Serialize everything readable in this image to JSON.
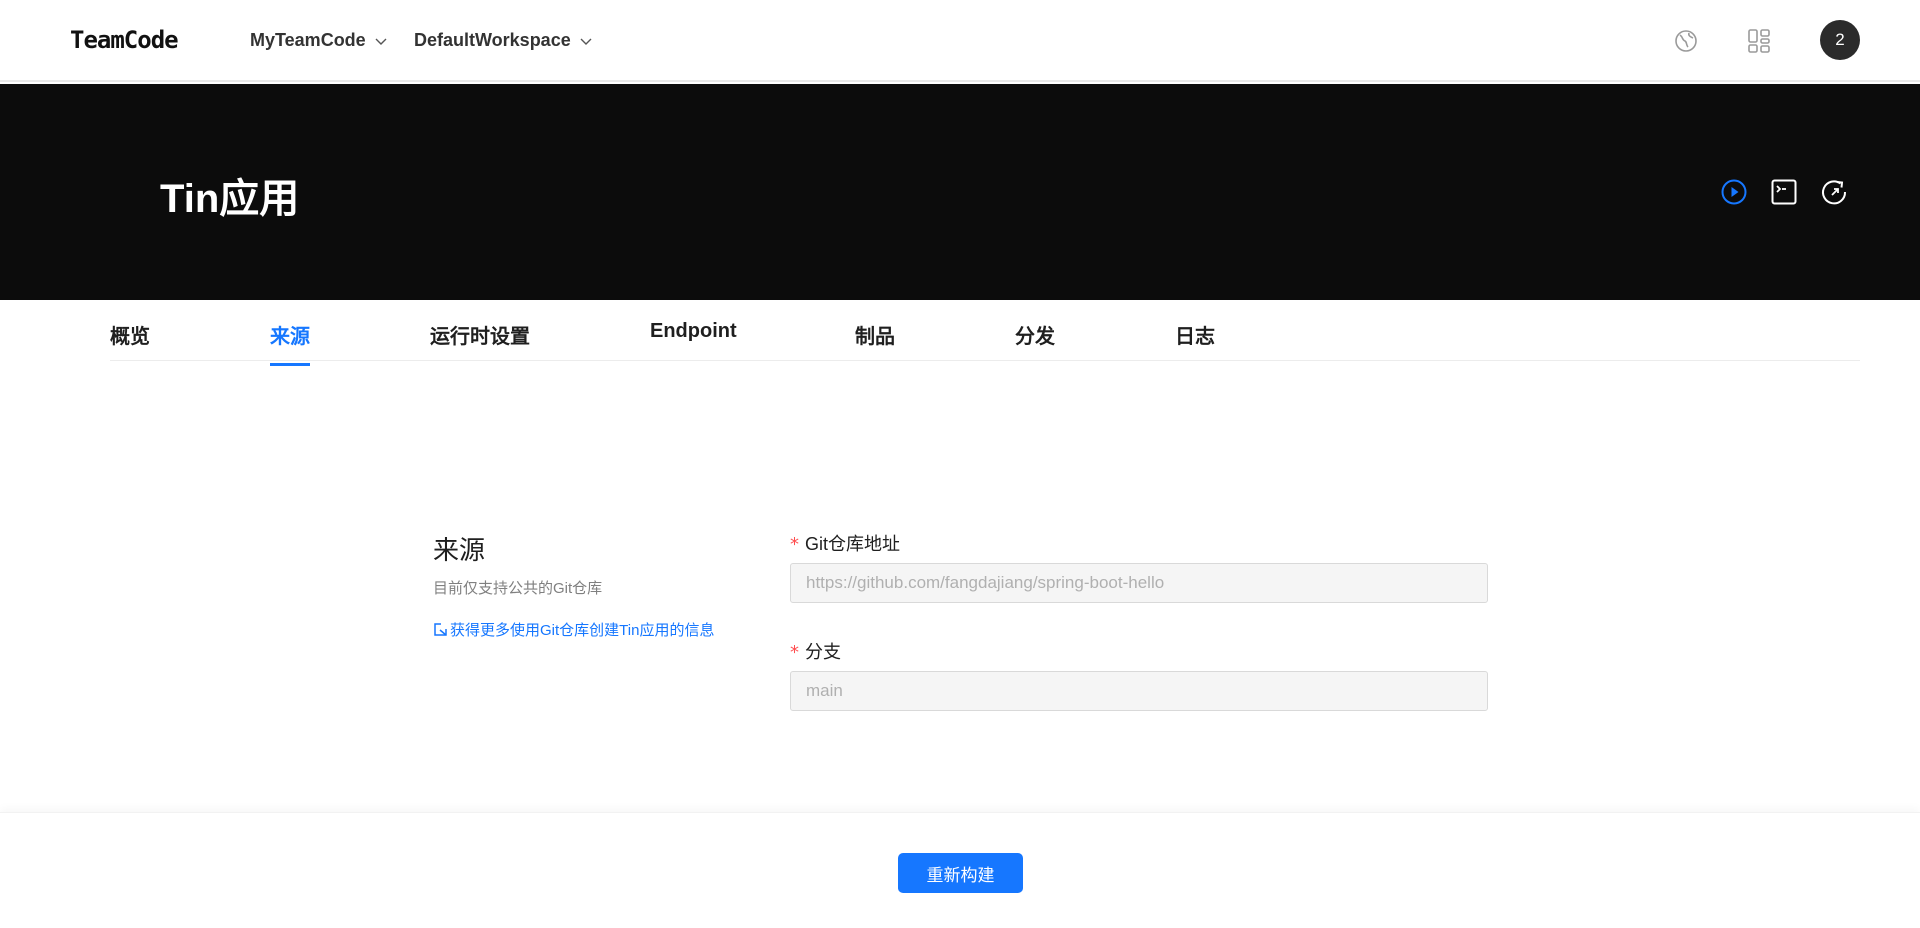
{
  "header": {
    "logo": "TeamCode",
    "team_select": "MyTeamCode",
    "workspace_select": "DefaultWorkspace",
    "avatar_badge": "2",
    "icons": [
      "globe-icon",
      "apps-icon"
    ]
  },
  "hero": {
    "title": "Tin应用",
    "icons": [
      "play-circle-icon",
      "terminal-icon",
      "redeploy-icon"
    ],
    "accent_color": "#1677ff"
  },
  "tabs": [
    {
      "label": "概览",
      "active": false
    },
    {
      "label": "来源",
      "active": true
    },
    {
      "label": "运行时设置",
      "active": false
    },
    {
      "label": "Endpoint",
      "active": false
    },
    {
      "label": "制品",
      "active": false
    },
    {
      "label": "分发",
      "active": false
    },
    {
      "label": "日志",
      "active": false
    }
  ],
  "source": {
    "title": "来源",
    "description": "目前仅支持公共的Git仓库",
    "link": "获得更多使用Git仓库创建Tin应用的信息",
    "fields": [
      {
        "label": "Git仓库地址",
        "required": true,
        "value": "https://github.com/fangdajiang/spring-boot-hello"
      },
      {
        "label": "分支",
        "required": true,
        "value": "main"
      }
    ]
  },
  "footer": {
    "rebuild_button": "重新构建"
  }
}
